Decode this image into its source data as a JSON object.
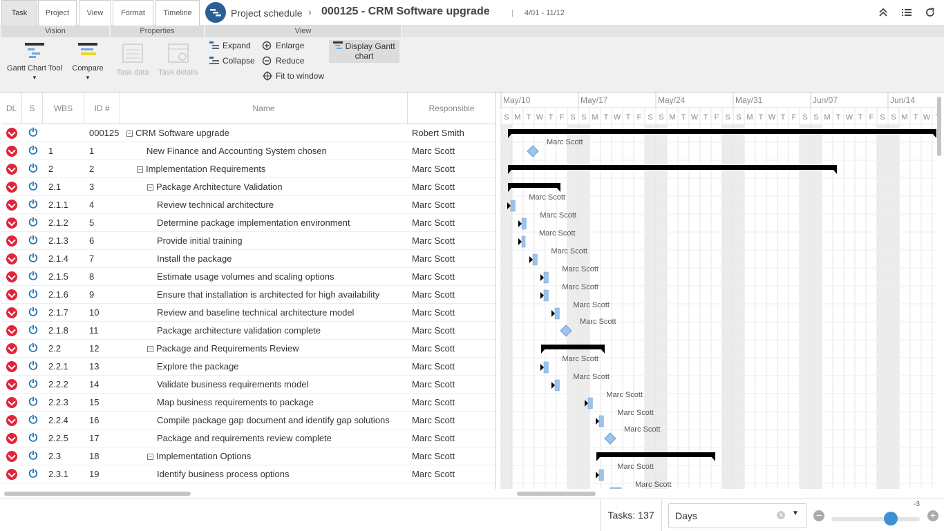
{
  "top_tabs": [
    {
      "label": "Task",
      "active": true
    },
    {
      "label": "Project",
      "active": false
    },
    {
      "label": "View",
      "active": false
    },
    {
      "label": "Format",
      "active": false
    },
    {
      "label": "Timeline",
      "active": false
    }
  ],
  "header": {
    "app_name": "Project schedule",
    "breadcrumb_separator": "›",
    "project_title": "000125 - CRM Software upgrade",
    "title_separator": "|",
    "date_range": "4/01 - 11/12",
    "icons": [
      "collapse-up-icon",
      "list-icon",
      "refresh-icon"
    ]
  },
  "ribbon": {
    "groups": {
      "vision": "Vision",
      "properties": "Properties",
      "view": "View"
    },
    "vision": {
      "gantt_chart_tool": "Gantt Chart Tool",
      "compare": "Compare"
    },
    "properties": {
      "task_data": "Task data",
      "task_details": "Task details"
    },
    "view": {
      "expand": "Expand",
      "collapse": "Collapse",
      "enlarge": "Enlarge",
      "reduce": "Reduce",
      "fit_to_window": "Fit to window",
      "display_gantt_chart": "Display Gantt chart"
    }
  },
  "grid": {
    "columns": {
      "dl": "DL",
      "s": "S",
      "wbs": "WBS",
      "id": "ID #",
      "name": "Name",
      "responsible": "Responsible"
    },
    "rows": [
      {
        "wbs": "",
        "id": "000125",
        "name": "CRM Software upgrade",
        "responsible": "Robert Smith",
        "level": 0,
        "summary": true
      },
      {
        "wbs": "1",
        "id": "1",
        "name": "New Finance and Accounting System chosen",
        "responsible": "Marc Scott",
        "level": 1,
        "summary": false
      },
      {
        "wbs": "2",
        "id": "2",
        "name": "Implementation Requirements",
        "responsible": "Marc Scott",
        "level": 1,
        "summary": true
      },
      {
        "wbs": "2.1",
        "id": "3",
        "name": "Package Architecture Validation",
        "responsible": "Marc Scott",
        "level": 2,
        "summary": true
      },
      {
        "wbs": "2.1.1",
        "id": "4",
        "name": "Review technical architecture",
        "responsible": "Marc Scott",
        "level": 3,
        "summary": false
      },
      {
        "wbs": "2.1.2",
        "id": "5",
        "name": "Determine package implementation environment",
        "responsible": "Marc Scott",
        "level": 3,
        "summary": false
      },
      {
        "wbs": "2.1.3",
        "id": "6",
        "name": "Provide initial training",
        "responsible": "Marc Scott",
        "level": 3,
        "summary": false
      },
      {
        "wbs": "2.1.4",
        "id": "7",
        "name": "Install the package",
        "responsible": "Marc Scott",
        "level": 3,
        "summary": false
      },
      {
        "wbs": "2.1.5",
        "id": "8",
        "name": "Estimate usage volumes and scaling options",
        "responsible": "Marc Scott",
        "level": 3,
        "summary": false
      },
      {
        "wbs": "2.1.6",
        "id": "9",
        "name": "Ensure that installation is architected for high availability",
        "responsible": "Marc Scott",
        "level": 3,
        "summary": false
      },
      {
        "wbs": "2.1.7",
        "id": "10",
        "name": "Review and baseline technical architecture model",
        "responsible": "Marc Scott",
        "level": 3,
        "summary": false
      },
      {
        "wbs": "2.1.8",
        "id": "11",
        "name": "Package architecture validation complete",
        "responsible": "Marc Scott",
        "level": 3,
        "summary": false
      },
      {
        "wbs": "2.2",
        "id": "12",
        "name": "Package and Requirements Review",
        "responsible": "Marc Scott",
        "level": 2,
        "summary": true
      },
      {
        "wbs": "2.2.1",
        "id": "13",
        "name": "Explore the package",
        "responsible": "Marc Scott",
        "level": 3,
        "summary": false
      },
      {
        "wbs": "2.2.2",
        "id": "14",
        "name": "Validate business requirements model",
        "responsible": "Marc Scott",
        "level": 3,
        "summary": false
      },
      {
        "wbs": "2.2.3",
        "id": "15",
        "name": "Map business requirements to package",
        "responsible": "Marc Scott",
        "level": 3,
        "summary": false
      },
      {
        "wbs": "2.2.4",
        "id": "16",
        "name": "Compile package gap document and identify gap solutions",
        "responsible": "Marc Scott",
        "level": 3,
        "summary": false
      },
      {
        "wbs": "2.2.5",
        "id": "17",
        "name": "Package and requirements review complete",
        "responsible": "Marc Scott",
        "level": 3,
        "summary": false
      },
      {
        "wbs": "2.3",
        "id": "18",
        "name": "Implementation Options",
        "responsible": "Marc Scott",
        "level": 2,
        "summary": true
      },
      {
        "wbs": "2.3.1",
        "id": "19",
        "name": "Identify business process options",
        "responsible": "Marc Scott",
        "level": 3,
        "summary": false
      }
    ]
  },
  "gantt": {
    "weeks": [
      "May/10",
      "May/17",
      "May/24",
      "May/31",
      "Jun/07",
      "Jun/14"
    ],
    "day_letters": [
      "S",
      "M",
      "T",
      "W",
      "T",
      "F",
      "S"
    ],
    "resource_label": "Marc Scott",
    "weekend_color": "#ececec",
    "bar_color": "#9cc3ea",
    "summary_color": "#000000",
    "tasks": [
      {
        "type": "summary",
        "start": 1,
        "end": 39
      },
      {
        "type": "milestone",
        "start": 2,
        "label": true
      },
      {
        "type": "summary",
        "start": 1,
        "end": 30
      },
      {
        "type": "summary",
        "start": 1,
        "end": 5
      },
      {
        "type": "task",
        "start": 1,
        "end": 1.4,
        "label": true
      },
      {
        "type": "task",
        "start": 2,
        "end": 2.4,
        "label": true
      },
      {
        "type": "task",
        "start": 2,
        "end": 2.3,
        "label": true
      },
      {
        "type": "task",
        "start": 3,
        "end": 3.4,
        "label": true
      },
      {
        "type": "task",
        "start": 4,
        "end": 4.4,
        "label": true
      },
      {
        "type": "task",
        "start": 4,
        "end": 4.4,
        "label": true
      },
      {
        "type": "task",
        "start": 5,
        "end": 5.4,
        "label": true
      },
      {
        "type": "milestone",
        "start": 5,
        "label": true
      },
      {
        "type": "summary",
        "start": 4,
        "end": 9
      },
      {
        "type": "task",
        "start": 4,
        "end": 4.4,
        "label": true
      },
      {
        "type": "task",
        "start": 5,
        "end": 5.4,
        "label": true
      },
      {
        "type": "task",
        "start": 8,
        "end": 8.4,
        "label": true
      },
      {
        "type": "task",
        "start": 9,
        "end": 9.4,
        "label": true
      },
      {
        "type": "milestone",
        "start": 9,
        "label": true
      },
      {
        "type": "summary",
        "start": 9,
        "end": 19
      },
      {
        "type": "task",
        "start": 9,
        "end": 9.4,
        "label": true
      },
      {
        "type": "task",
        "start": 10,
        "end": 11,
        "label": true
      }
    ]
  },
  "status": {
    "tasks_label": "Tasks:",
    "tasks_count": "137",
    "scale_value": "Days",
    "zoom_value": "-3",
    "zoom_level": 0.67
  }
}
